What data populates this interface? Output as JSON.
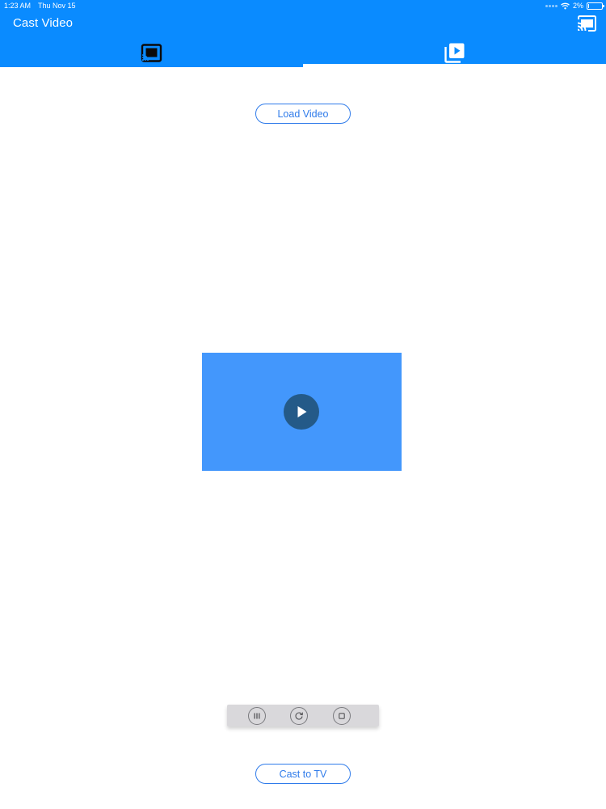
{
  "status_bar": {
    "time": "1:23 AM",
    "date": "Thu Nov 15",
    "battery_text": "2%",
    "battery_level": 0.02
  },
  "nav": {
    "title": "Cast Video",
    "cast_icon": "cast-icon"
  },
  "tabs": [
    {
      "icon": "cast-connected-icon",
      "selected": false
    },
    {
      "icon": "video-library-icon",
      "selected": true
    }
  ],
  "buttons": {
    "load_video": "Load Video",
    "cast_to_tv": "Cast to TV"
  },
  "video": {
    "thumbnail_color": "#4397FC",
    "play_icon": "play-icon"
  },
  "controls": {
    "icons": [
      "pause-icon",
      "replay-icon",
      "stop-icon"
    ]
  },
  "colors": {
    "header": "#0A8BFF",
    "accent": "#2F7BEA",
    "play_circle": "#245A88",
    "controls_bg": "#D9D8DB"
  }
}
